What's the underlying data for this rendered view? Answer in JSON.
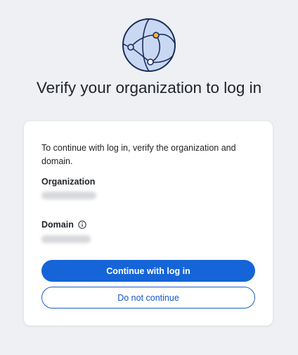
{
  "logo": {
    "icon": "globe-network-icon",
    "colors": {
      "fill": "#c9d8f2",
      "stroke": "#1a2c5b",
      "accent": "#f2b63a"
    }
  },
  "page": {
    "title": "Verify your organization to log in"
  },
  "card": {
    "intro": "To continue with log in, verify the organization and domain.",
    "organization_label": "Organization",
    "organization_value": "",
    "domain_label": "Domain",
    "domain_value": "",
    "info_icon": "info-icon"
  },
  "buttons": {
    "continue_label": "Continue with log in",
    "cancel_label": "Do not continue"
  },
  "colors": {
    "primary": "#1565d8",
    "background": "#eef0f3"
  }
}
